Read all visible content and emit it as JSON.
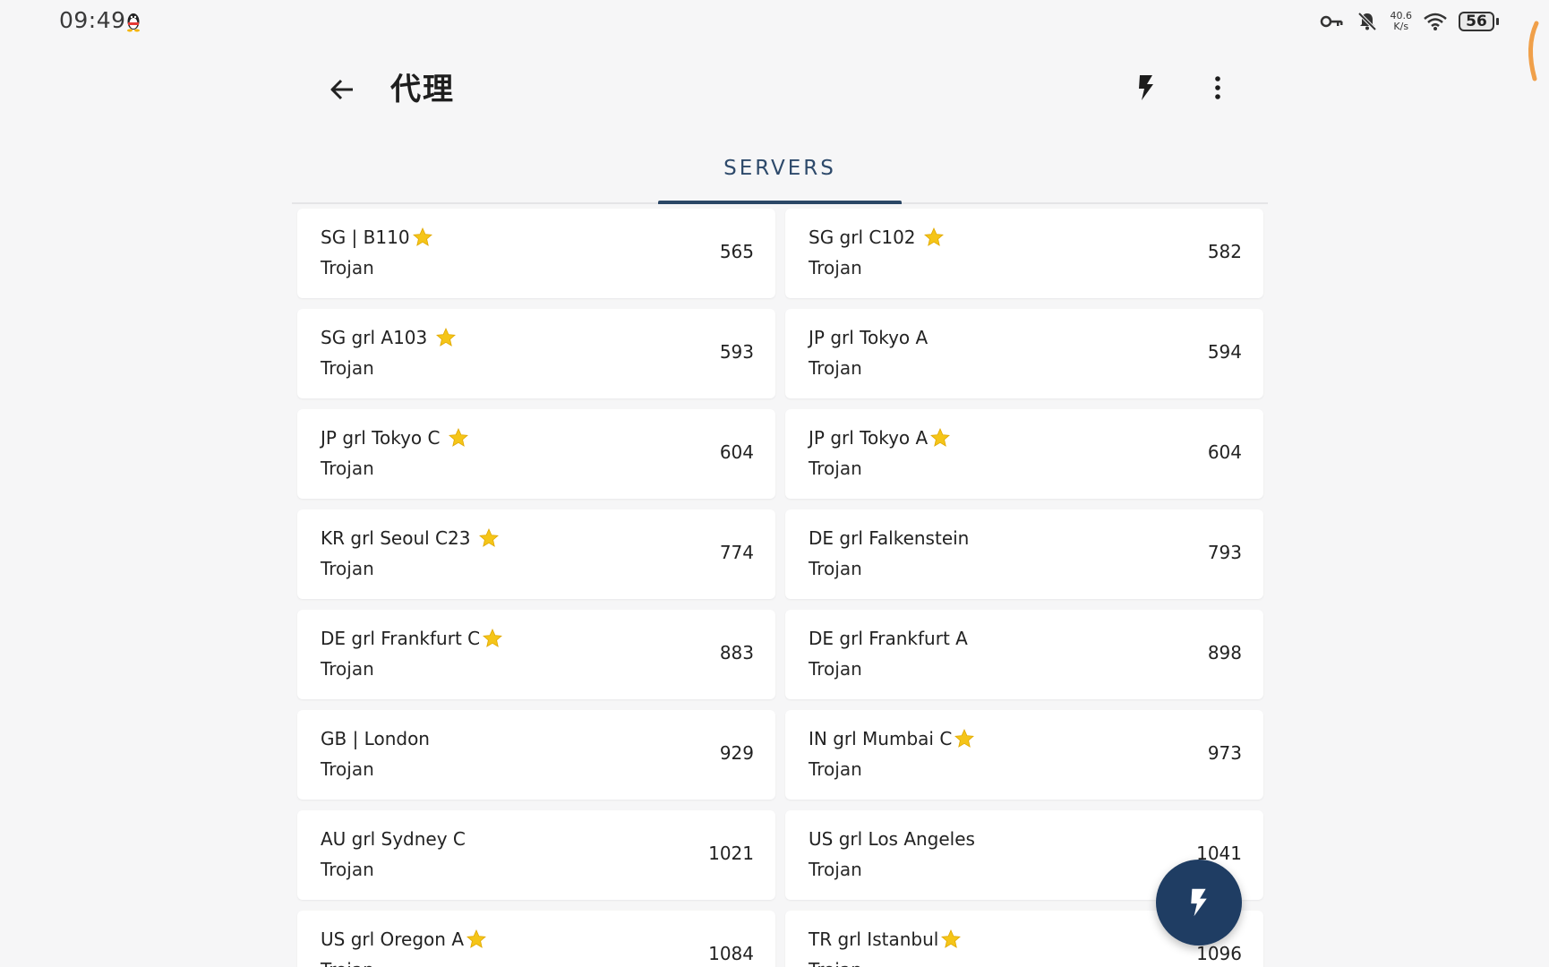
{
  "status_bar": {
    "time": "09:49",
    "net_speed_value": "40.6",
    "net_speed_unit": "K/s",
    "battery_level": "56"
  },
  "app_bar": {
    "title": "代理"
  },
  "tabs": [
    {
      "label": "SERVERS",
      "selected": true
    }
  ],
  "colors": {
    "accent": "#2b4766",
    "fab": "#1f3d63",
    "background": "#f6f6f7",
    "card": "#ffffff",
    "star": "#f5c518"
  },
  "servers": [
    {
      "name": "SG | B110",
      "star": true,
      "type": "Trojan",
      "latency": "565"
    },
    {
      "name": "SG grl C102 ",
      "star": true,
      "type": "Trojan",
      "latency": "582"
    },
    {
      "name": "SG grl A103 ",
      "star": true,
      "type": "Trojan",
      "latency": "593"
    },
    {
      "name": "JP grl Tokyo A",
      "star": false,
      "type": "Trojan",
      "latency": "594"
    },
    {
      "name": "JP grl Tokyo C ",
      "star": true,
      "type": "Trojan",
      "latency": "604"
    },
    {
      "name": "JP grl Tokyo A",
      "star": true,
      "type": "Trojan",
      "latency": "604"
    },
    {
      "name": "KR grl Seoul C23 ",
      "star": true,
      "type": "Trojan",
      "latency": "774"
    },
    {
      "name": "DE grl Falkenstein",
      "star": false,
      "type": "Trojan",
      "latency": "793"
    },
    {
      "name": "DE grl Frankfurt C",
      "star": true,
      "type": "Trojan",
      "latency": "883"
    },
    {
      "name": "DE grl Frankfurt A",
      "star": false,
      "type": "Trojan",
      "latency": "898"
    },
    {
      "name": "GB | London",
      "star": false,
      "type": "Trojan",
      "latency": "929"
    },
    {
      "name": "IN grl Mumbai C",
      "star": true,
      "type": "Trojan",
      "latency": "973"
    },
    {
      "name": "AU grl Sydney C",
      "star": false,
      "type": "Trojan",
      "latency": "1021"
    },
    {
      "name": "US grl Los Angeles",
      "star": false,
      "type": "Trojan",
      "latency": "1041"
    },
    {
      "name": "US grl Oregon A",
      "star": true,
      "type": "Trojan",
      "latency": "1084"
    },
    {
      "name": "TR grl Istanbul",
      "star": true,
      "type": "Trojan",
      "latency": "1096"
    }
  ],
  "icons": {
    "back": "arrow-left",
    "bolt": "lightning-bolt",
    "more": "more-vertical",
    "fab": "lightning-bolt"
  }
}
